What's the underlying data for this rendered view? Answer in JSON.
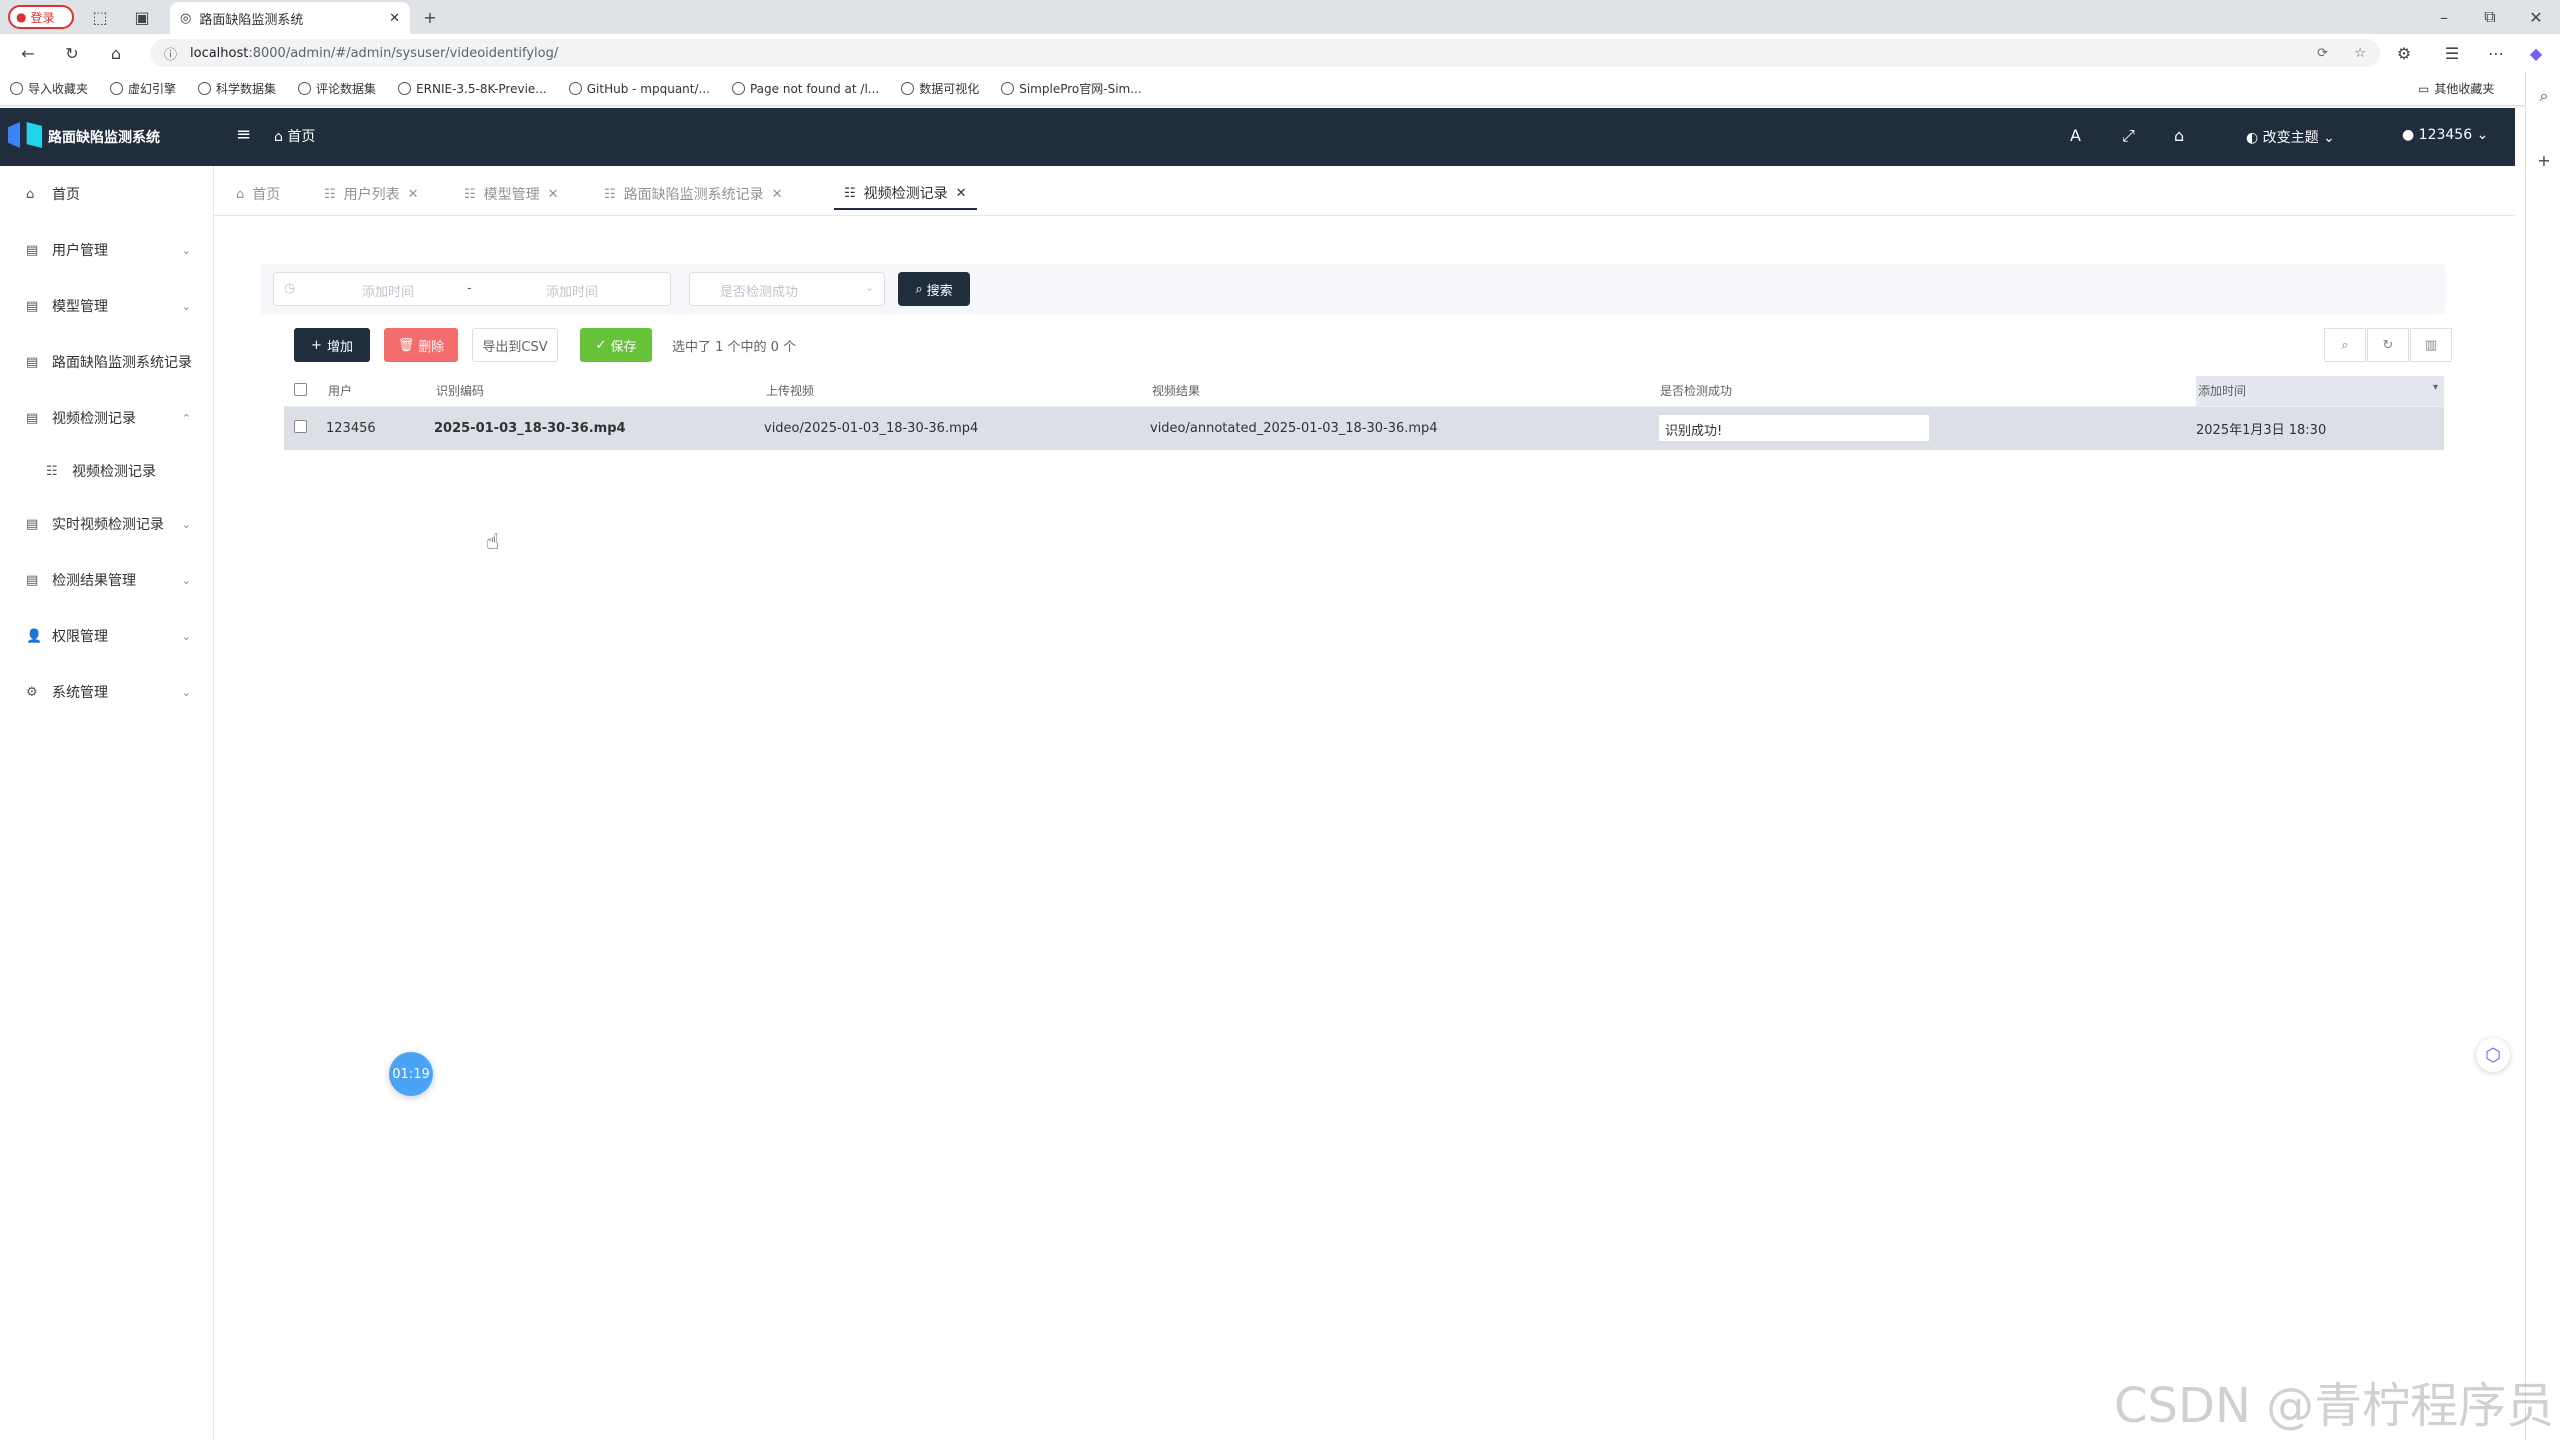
{
  "browser": {
    "profile_label": "登录",
    "tab_title": "路面缺陷监测系统",
    "url_host": "localhost",
    "url_rest": ":8000/admin/#/admin/sysuser/videoidentifylog/",
    "bookmarks": [
      "导入收藏夹",
      "虚幻引擎",
      "科学数据集",
      "评论数据集",
      "ERNIE-3.5-8K-Previe...",
      "GitHub - mpquant/...",
      "Page not found at /l...",
      "数据可视化",
      "SimplePro官网-Sim..."
    ],
    "other_bookmarks": "其他收藏夹"
  },
  "app": {
    "brand": "路面缺陷监测系统",
    "nav_home": "首页",
    "theme_label": "改变主题",
    "username": "123456"
  },
  "sidebar": {
    "items": [
      {
        "label": "首页"
      },
      {
        "label": "用户管理"
      },
      {
        "label": "模型管理"
      },
      {
        "label": "路面缺陷监测系统记录"
      },
      {
        "label": "视频检测记录"
      },
      {
        "label": "视频检测记录"
      },
      {
        "label": "实时视频检测记录"
      },
      {
        "label": "检测结果管理"
      },
      {
        "label": "权限管理"
      },
      {
        "label": "系统管理"
      }
    ]
  },
  "tags": [
    "首页",
    "用户列表",
    "模型管理",
    "路面缺陷监测系统记录",
    "视频检测记录"
  ],
  "filter": {
    "start_placeholder": "添加时间",
    "separator": "-",
    "end_placeholder": "添加时间",
    "select_placeholder": "是否检测成功",
    "search_label": "搜索"
  },
  "actions": {
    "add": "增加",
    "delete": "删除",
    "export": "导出到CSV",
    "save": "保存",
    "selected_text": "选中了 1 个中的 0 个"
  },
  "table": {
    "headers": [
      "用户",
      "识别编码",
      "上传视频",
      "视频结果",
      "是否检测成功",
      "添加时间"
    ],
    "rows": [
      {
        "user": "123456",
        "code": "2025-01-03_18-30-36.mp4",
        "upload": "video/2025-01-03_18-30-36.mp4",
        "result": "video/annotated_2025-01-03_18-30-36.mp4",
        "success": "识别成功!",
        "time": "2025年1月3日 18:30"
      }
    ]
  },
  "timer": "01:19",
  "watermark": "CSDN @青柠程序员"
}
